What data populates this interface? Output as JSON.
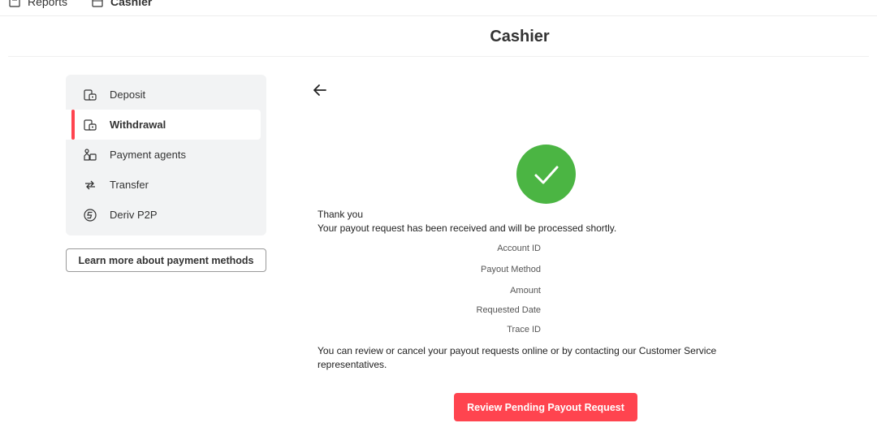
{
  "topnav": {
    "reports_label": "Reports",
    "cashier_label": "Cashier"
  },
  "header": {
    "title": "Cashier"
  },
  "sidebar": {
    "items": [
      {
        "label": "Deposit",
        "icon": "wallet-icon",
        "active": false
      },
      {
        "label": "Withdrawal",
        "icon": "wallet-icon",
        "active": true
      },
      {
        "label": "Payment agents",
        "icon": "payment-agent-icon",
        "active": false
      },
      {
        "label": "Transfer",
        "icon": "transfer-icon",
        "active": false
      },
      {
        "label": "Deriv P2P",
        "icon": "p2p-icon",
        "active": false
      }
    ],
    "learn_more_label": "Learn more about payment methods"
  },
  "main": {
    "thank_you": "Thank you",
    "received_message": "Your payout request has been received and will be processed shortly.",
    "details": {
      "account_id_label": "Account ID",
      "payout_method_label": "Payout Method",
      "amount_label": "Amount",
      "requested_date_label": "Requested Date",
      "trace_id_label": "Trace ID"
    },
    "review_message": "You can review or cancel your payout requests online or by contacting our Customer Service representatives.",
    "review_button_label": "Review Pending Payout Request"
  },
  "colors": {
    "accent": "#ff444f",
    "success": "#4bb543",
    "sidebar_bg": "#f2f3f4"
  }
}
